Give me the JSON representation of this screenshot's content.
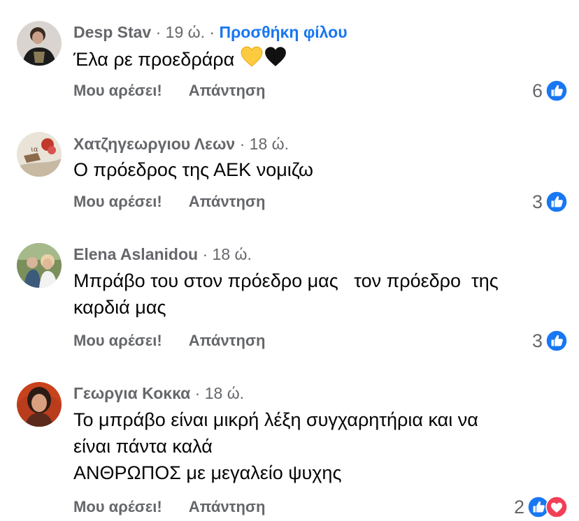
{
  "colors": {
    "meta_gray": "#65676b",
    "link_blue": "#1877f2",
    "text_black": "#050505",
    "like_blue": "#1877f2",
    "love_red": "#f33e58"
  },
  "comments": [
    {
      "author": "Desp Stav",
      "separator": "·",
      "time": "19 ώ.",
      "separator2": "·",
      "add_friend": "Προσθήκη φίλου",
      "text_lines": [
        "Έλα ρε προεδράρα"
      ],
      "emojis": [
        "yellow-heart",
        "black-heart"
      ],
      "like_label": "Μου αρέσει!",
      "reply_label": "Απάντηση",
      "reaction_count": "6",
      "reactions": [
        "like-icon"
      ]
    },
    {
      "author": "Χατζηγεωργιου Λεων",
      "separator": "·",
      "time": "18 ώ.",
      "text_lines": [
        "Ο πρόεδρος της ΑΕΚ νομιζω"
      ],
      "like_label": "Μου αρέσει!",
      "reply_label": "Απάντηση",
      "reaction_count": "3",
      "reactions": [
        "like-icon"
      ]
    },
    {
      "author": "Elena Aslanidou",
      "separator": "·",
      "time": "18 ώ.",
      "text_lines": [
        "Μπράβο του στον πρόεδρο μας   τον πρόεδρο  της",
        "καρδιά μας"
      ],
      "like_label": "Μου αρέσει!",
      "reply_label": "Απάντηση",
      "reaction_count": "3",
      "reactions": [
        "like-icon"
      ]
    },
    {
      "author": "Γεωργια Κοκκα",
      "separator": "·",
      "time": "18 ώ.",
      "text_lines": [
        "Το μπράβο είναι μικρή λέξη συγχαρητήρια και να",
        "είναι πάντα καλά",
        "ΑΝΘΡΩΠΟΣ με μεγαλείο ψυχης"
      ],
      "like_label": "Μου αρέσει!",
      "reply_label": "Απάντηση",
      "reaction_count": "2",
      "reactions": [
        "like-icon",
        "love-icon"
      ]
    }
  ]
}
